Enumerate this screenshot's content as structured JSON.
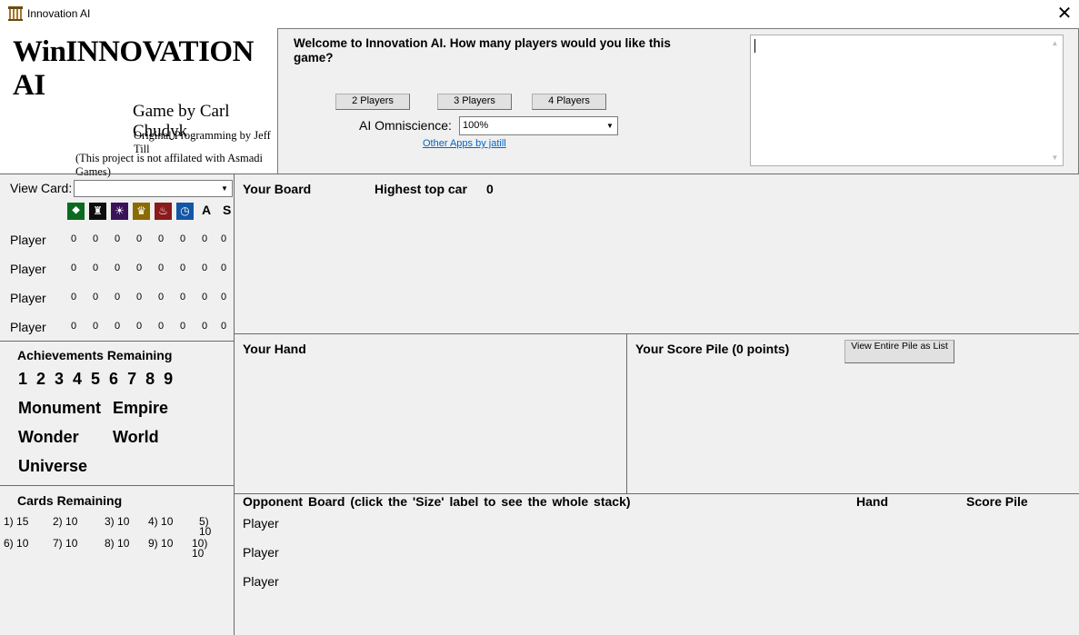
{
  "window": {
    "title": "Innovation AI",
    "close_glyph": "✕"
  },
  "logo": {
    "title": "WinINNOVATION AI",
    "byline": "Game by Carl Chudyk",
    "programming": "Original Programming by Jeff Till",
    "affiliation": "(This project is not affilated with Asmadi Games)"
  },
  "setup": {
    "prompt": "Welcome to Innovation AI.  How many players would you like this game?",
    "buttons": [
      "2 Players",
      "3 Players",
      "4 Players"
    ],
    "omniscience_label": "AI Omniscience:",
    "omniscience_value": "100%",
    "other_apps_link": "Other Apps by jatill"
  },
  "left_panel": {
    "view_card_label": "View Card:",
    "view_card_value": "",
    "icon_columns": [
      {
        "name": "leaf-icon",
        "color": "#0a6b1f",
        "glyph": "⯁"
      },
      {
        "name": "castle-icon",
        "color": "#0d0d0d",
        "glyph": "♜"
      },
      {
        "name": "lightbulb-icon",
        "color": "#3a1459",
        "glyph": "☀"
      },
      {
        "name": "crown-icon",
        "color": "#8a6b00",
        "glyph": "♛"
      },
      {
        "name": "factory-icon",
        "color": "#8b1a1a",
        "glyph": "♨"
      },
      {
        "name": "clock-icon",
        "color": "#1456a6",
        "glyph": "◷"
      }
    ],
    "letter_columns": [
      "A",
      "S"
    ],
    "players": [
      {
        "label": "Player",
        "counts": [
          "0",
          "0",
          "0",
          "0",
          "0",
          "0",
          "0",
          "0"
        ]
      },
      {
        "label": "Player",
        "counts": [
          "0",
          "0",
          "0",
          "0",
          "0",
          "0",
          "0",
          "0"
        ]
      },
      {
        "label": "Player",
        "counts": [
          "0",
          "0",
          "0",
          "0",
          "0",
          "0",
          "0",
          "0"
        ]
      },
      {
        "label": "Player",
        "counts": [
          "0",
          "0",
          "0",
          "0",
          "0",
          "0",
          "0",
          "0"
        ]
      }
    ],
    "achievements_title": "Achievements Remaining",
    "achievement_numbers": "1 2 3 4 5 6 7 8 9",
    "special_achievements": [
      "Monument",
      "Empire",
      "Wonder",
      "World",
      "Universe"
    ],
    "cards_title": "Cards Remaining",
    "cards_remaining": [
      {
        "label": "1)",
        "value": "15"
      },
      {
        "label": "2)",
        "value": "10"
      },
      {
        "label": "3)",
        "value": "10"
      },
      {
        "label": "4)",
        "value": "10"
      },
      {
        "label": "5)",
        "value": "10"
      },
      {
        "label": "6)",
        "value": "10"
      },
      {
        "label": "7)",
        "value": "10"
      },
      {
        "label": "8)",
        "value": "10"
      },
      {
        "label": "9)",
        "value": "10"
      },
      {
        "label": "10)",
        "value": "10"
      }
    ]
  },
  "board": {
    "title": "Your Board",
    "highest_label": "Highest top car",
    "highest_value": "0"
  },
  "hand": {
    "title": "Your Hand"
  },
  "score_pile": {
    "title": "Your Score Pile (0 points)",
    "view_button": "View Entire Pile as List"
  },
  "opponents": {
    "title": "Opponent  Board   (click the 'Size' label to see the whole stack)",
    "hand_header": "Hand",
    "score_header": "Score Pile",
    "players": [
      "Player",
      "Player",
      "Player"
    ]
  }
}
